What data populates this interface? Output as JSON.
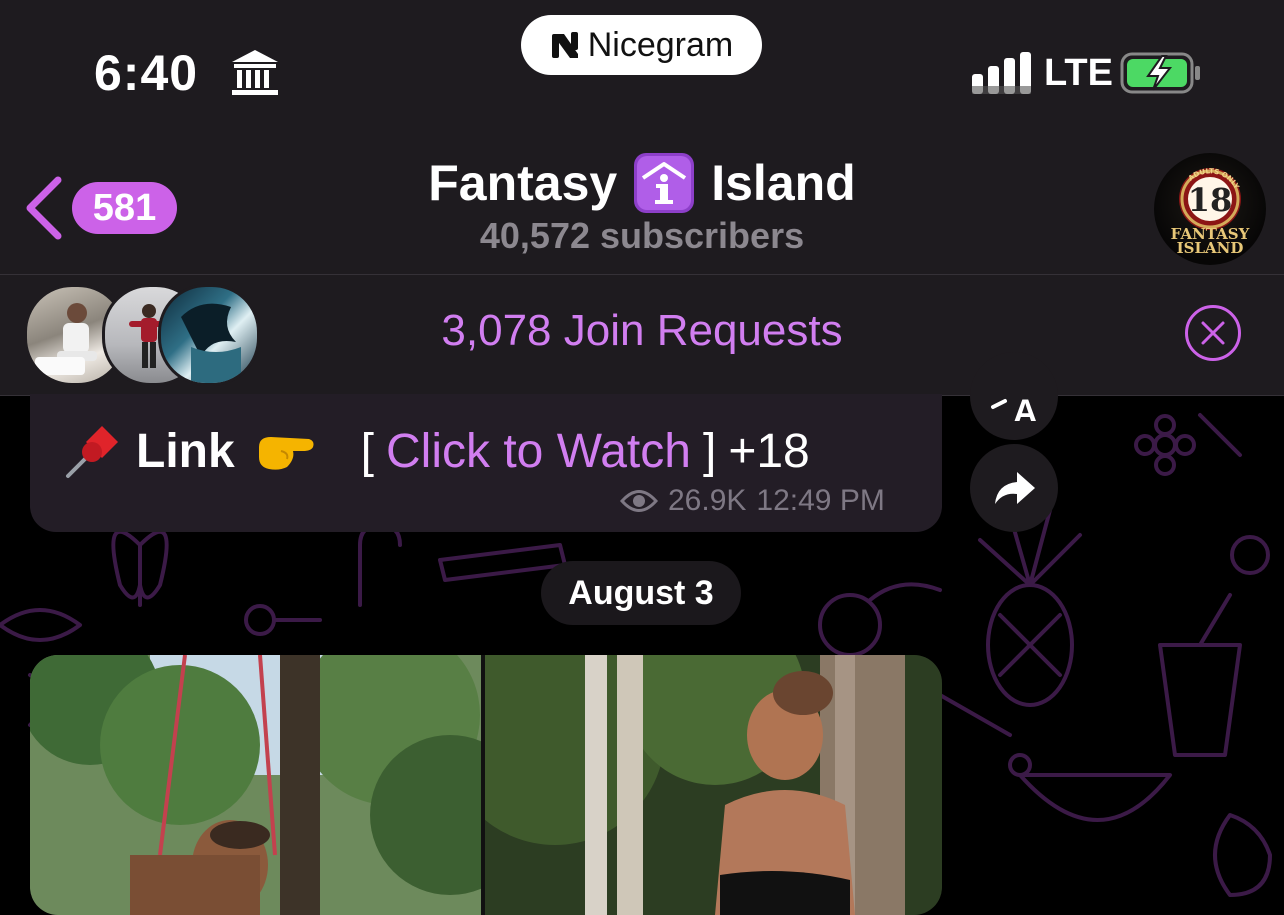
{
  "status_bar": {
    "time": "6:40",
    "network": "LTE",
    "app_pill": "Nicegram",
    "icons": [
      "bank-icon",
      "signal-icon",
      "battery-charging-icon"
    ]
  },
  "header": {
    "back_badge": "581",
    "channel_title_left": "Fantasy",
    "channel_title_right": "Island",
    "subscribers": "40,572 subscribers",
    "avatar": {
      "badge_text": "ADULTS ONLY",
      "number": "18",
      "name_line1": "FANTASY",
      "name_line2": "ISLAND"
    }
  },
  "join_requests": {
    "label": "3,078 Join Requests"
  },
  "message": {
    "prefix": "Link",
    "bracket_open": "[",
    "link_text": "Click to Watch",
    "bracket_close": "]",
    "suffix": "+18",
    "views": "26.9K",
    "time": "12:49 PM"
  },
  "date_separator": "August 3",
  "colors": {
    "accent": "#d17ef0",
    "badge": "#cc62e8",
    "bar_bg": "#1e1b1f",
    "chat_bg": "#000000",
    "doodle": "#3b1a47"
  }
}
